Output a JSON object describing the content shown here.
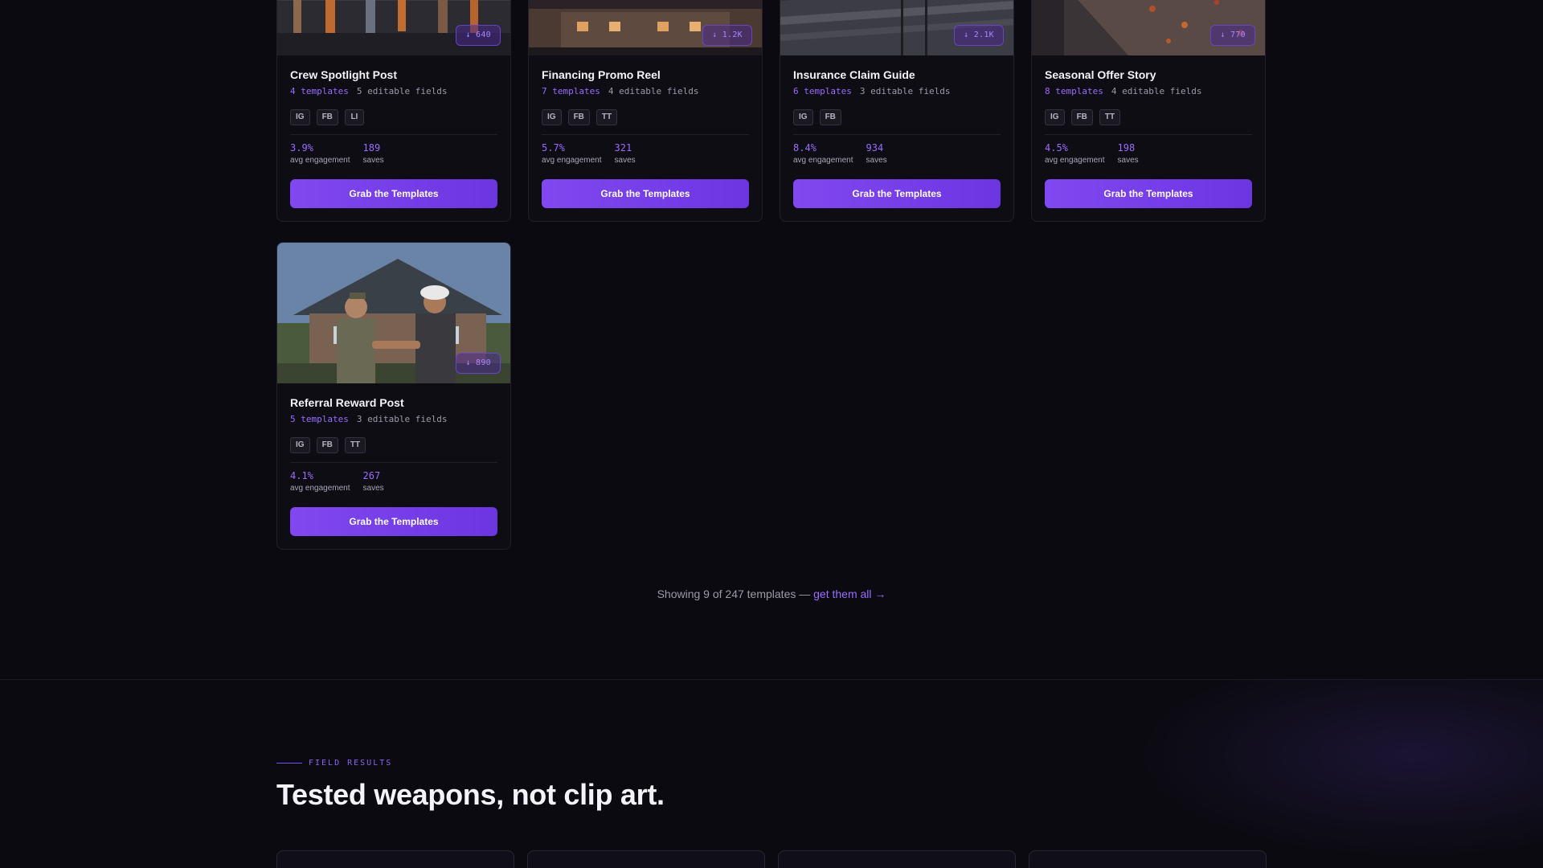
{
  "cards": [
    {
      "title": "Crew Spotlight Post",
      "templates": "4 templates",
      "fields": "5 editable fields",
      "tags": [
        "IG",
        "FB",
        "LI"
      ],
      "downloads": "↓ 640",
      "engagement": "3.9%",
      "engagement_label": "avg engagement",
      "saves": "189",
      "saves_label": "saves",
      "button": "Grab the Templates",
      "image": "crew-photo"
    },
    {
      "title": "Financing Promo Reel",
      "templates": "7 templates",
      "fields": "4 editable fields",
      "tags": [
        "IG",
        "FB",
        "TT"
      ],
      "downloads": "↓ 1.2K",
      "engagement": "5.7%",
      "engagement_label": "avg engagement",
      "saves": "321",
      "saves_label": "saves",
      "button": "Grab the Templates",
      "image": "house-photo"
    },
    {
      "title": "Insurance Claim Guide",
      "templates": "6 templates",
      "fields": "3 editable fields",
      "tags": [
        "IG",
        "FB"
      ],
      "downloads": "↓ 2.1K",
      "engagement": "8.4%",
      "engagement_label": "avg engagement",
      "saves": "934",
      "saves_label": "saves",
      "button": "Grab the Templates",
      "image": "roof-damage-photo"
    },
    {
      "title": "Seasonal Offer Story",
      "templates": "8 templates",
      "fields": "4 editable fields",
      "tags": [
        "IG",
        "FB",
        "TT"
      ],
      "downloads": "↓ 770",
      "engagement": "4.5%",
      "engagement_label": "avg engagement",
      "saves": "198",
      "saves_label": "saves",
      "button": "Grab the Templates",
      "image": "autumn-roof-photo"
    },
    {
      "title": "Referral Reward Post",
      "templates": "5 templates",
      "fields": "3 editable fields",
      "tags": [
        "IG",
        "FB",
        "TT"
      ],
      "downloads": "↓ 890",
      "engagement": "4.1%",
      "engagement_label": "avg engagement",
      "saves": "267",
      "saves_label": "saves",
      "button": "Grab the Templates",
      "image": "handshake-photo"
    }
  ],
  "footer": {
    "showing": "Showing 9 of 247 templates — ",
    "link": "get them all →"
  },
  "results": {
    "eyebrow": "FIELD RESULTS",
    "headline": "Tested weapons, not clip art."
  },
  "colors": {
    "accent": "#8148f0",
    "accent_text": "#9a6cff",
    "background": "#0b0a10"
  }
}
